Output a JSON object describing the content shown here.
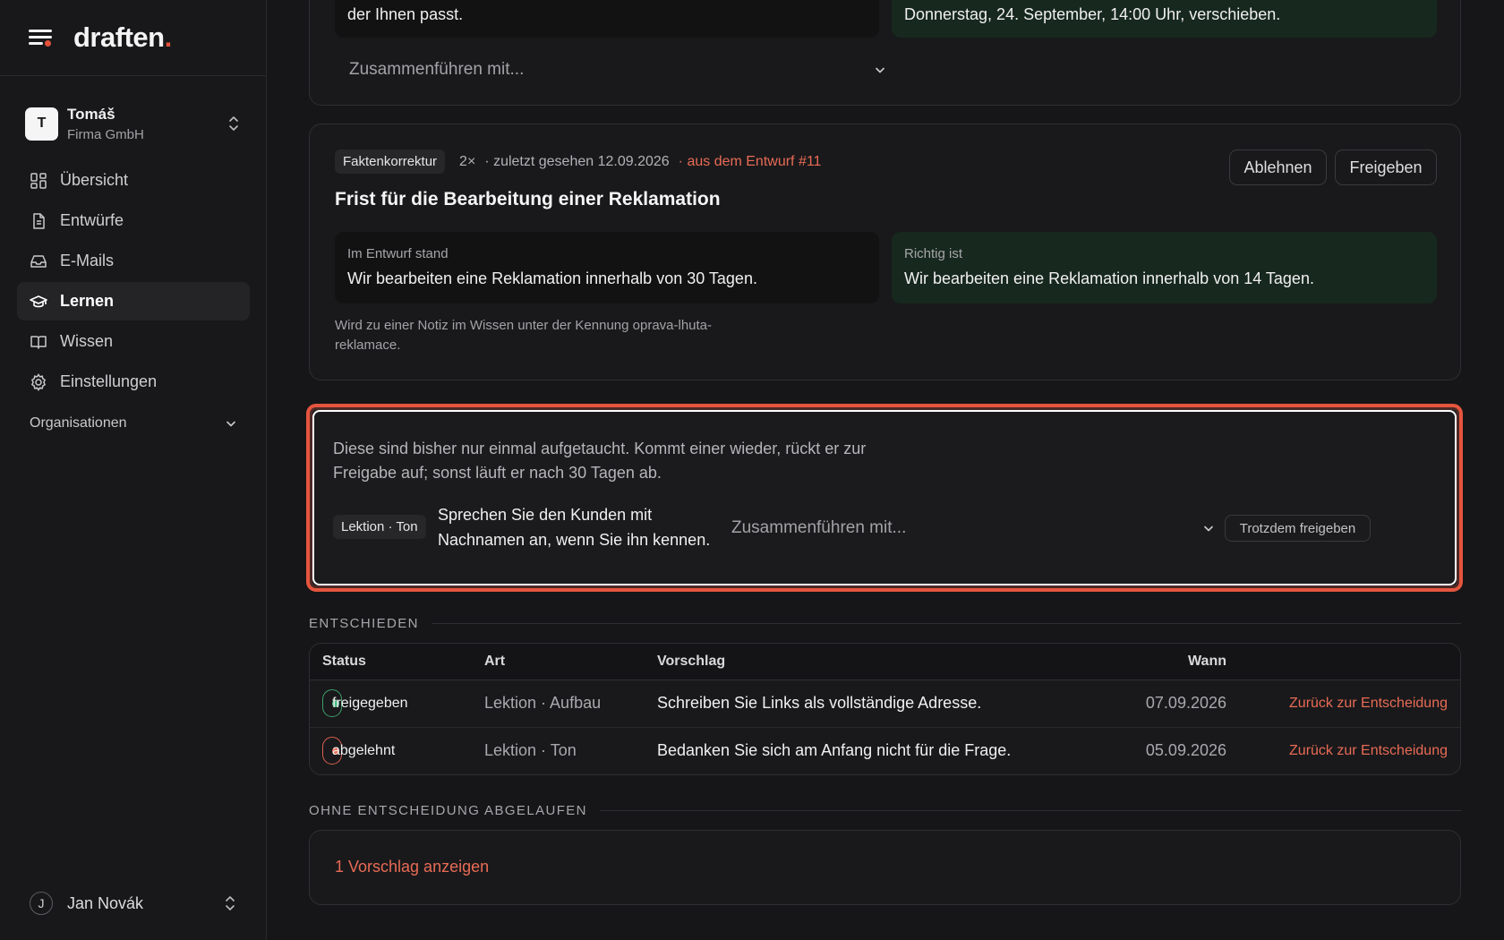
{
  "brand": {
    "logo_text": "draften",
    "logo_dot": ".",
    "accent_color": "#e4513a"
  },
  "account": {
    "initial": "T",
    "name": "Tomáš",
    "org": "Firma GmbH"
  },
  "nav": {
    "items": [
      {
        "label": "Übersicht",
        "icon": "dashboard-icon"
      },
      {
        "label": "Entwürfe",
        "icon": "document-icon"
      },
      {
        "label": "E-Mails",
        "icon": "inbox-icon"
      },
      {
        "label": "Lernen",
        "icon": "graduation-cap-icon",
        "active": true
      },
      {
        "label": "Wissen",
        "icon": "book-icon"
      },
      {
        "label": "Einstellungen",
        "icon": "gear-icon"
      }
    ],
    "organisations_label": "Organisationen"
  },
  "user": {
    "initial": "J",
    "name": "Jan Novák"
  },
  "top_card": {
    "left_text": "der Ihnen passt.",
    "right_text": "Donnerstag, 24. September, 14:00 Uhr, verschieben.",
    "merge_placeholder": "Zusammenführen mit..."
  },
  "fact_card": {
    "tag": "Faktenkorrektur",
    "count": "2×",
    "last_seen": "· zuletzt gesehen 12.09.2026",
    "source": "· aus dem Entwurf #11",
    "title": "Frist für die Bearbeitung einer Reklamation",
    "reject_label": "Ablehnen",
    "approve_label": "Freigeben",
    "was_caption": "Im Entwurf stand",
    "was_text": "Wir bearbeiten eine Reklamation innerhalb von 30 Tagen.",
    "correct_caption": "Richtig ist",
    "correct_text": "Wir bearbeiten eine Reklamation innerhalb von 14 Tagen.",
    "note": "Wird zu einer Notiz im Wissen unter der Kennung oprava-lhuta-reklamace."
  },
  "single_card": {
    "description": "Diese sind bisher nur einmal aufgetaucht. Kommt einer wieder, rückt er zur Freigabe auf; sonst läuft er nach 30 Tagen ab.",
    "tag": "Lektion · Ton",
    "text": "Sprechen Sie den Kunden mit Nachnamen an, wenn Sie ihn kennen.",
    "merge_placeholder": "Zusammenführen mit...",
    "approve_anyway_label": "Trotzdem freigeben"
  },
  "decided": {
    "section_label": "ENTSCHIEDEN",
    "headers": {
      "status": "Status",
      "art": "Art",
      "proposal": "Vorschlag",
      "when": "Wann"
    },
    "rows": [
      {
        "status": "freigegeben",
        "status_color": "#4fb985",
        "art": "Lektion · Aufbau",
        "proposal": "Schreiben Sie Links als vollständige Adresse.",
        "when": "07.09.2026",
        "action": "Zurück zur Entscheidung"
      },
      {
        "status": "abgelehnt",
        "status_color": "#e86b55",
        "art": "Lektion · Ton",
        "proposal": "Bedanken Sie sich am Anfang nicht für die Frage.",
        "when": "05.09.2026",
        "action": "Zurück zur Entscheidung"
      }
    ]
  },
  "expired": {
    "section_label": "OHNE ENTSCHEIDUNG ABGELAUFEN",
    "link": "1 Vorschlag anzeigen"
  }
}
